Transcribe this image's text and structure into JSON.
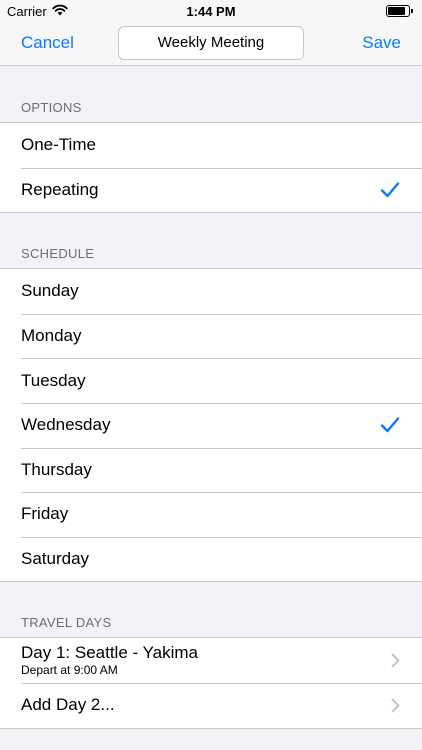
{
  "status": {
    "carrier": "Carrier",
    "time": "1:44 PM",
    "battery_level": 0.85
  },
  "nav": {
    "cancel_label": "Cancel",
    "title_value": "Weekly Meeting",
    "save_label": "Save"
  },
  "options": {
    "header": "OPTIONS",
    "items": [
      {
        "label": "One-Time",
        "checked": false
      },
      {
        "label": "Repeating",
        "checked": true
      }
    ]
  },
  "schedule": {
    "header": "SCHEDULE",
    "items": [
      {
        "label": "Sunday",
        "checked": false
      },
      {
        "label": "Monday",
        "checked": false
      },
      {
        "label": "Tuesday",
        "checked": false
      },
      {
        "label": "Wednesday",
        "checked": true
      },
      {
        "label": "Thursday",
        "checked": false
      },
      {
        "label": "Friday",
        "checked": false
      },
      {
        "label": "Saturday",
        "checked": false
      }
    ]
  },
  "travel": {
    "header": "TRAVEL DAYS",
    "items": [
      {
        "label": "Day 1: Seattle - Yakima",
        "subtitle": "Depart at 9:00 AM"
      },
      {
        "label": "Add Day 2..."
      }
    ]
  },
  "colors": {
    "accent": "#0a7aff",
    "background": "#f2f2f7",
    "separator": "#c8c7cc",
    "chevron": "#c4c4c7"
  }
}
